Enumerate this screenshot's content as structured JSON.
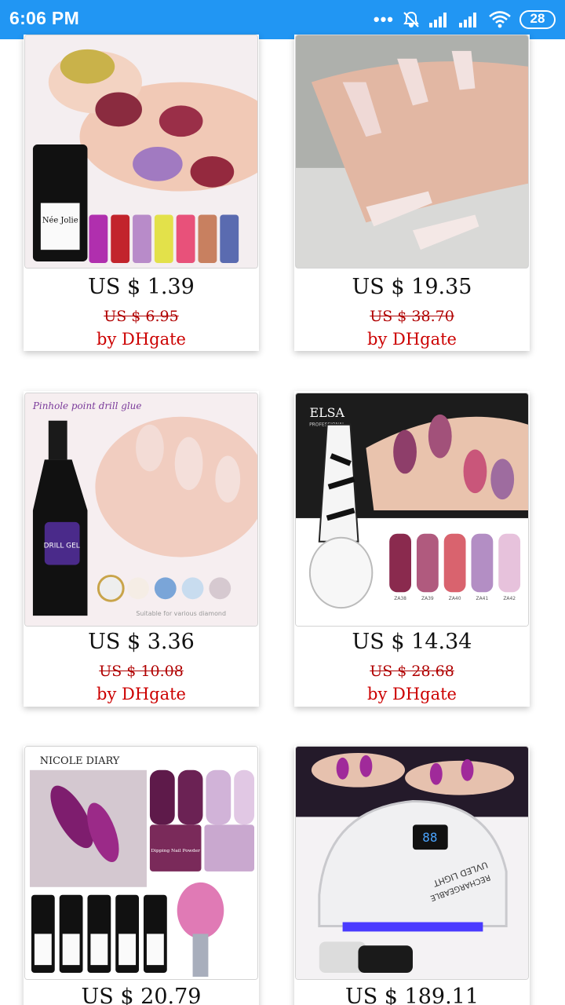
{
  "status_bar": {
    "time": "6:06 PM",
    "dots": "•••",
    "battery": "28",
    "icons": [
      "more-dots-icon",
      "notifications-off-icon",
      "signal-icon",
      "signal-icon",
      "wifi-icon",
      "battery-icon"
    ]
  },
  "products": [
    {
      "price": "US $ 1.39",
      "old_price": "US $ 6.95",
      "seller": "by DHgate",
      "image_brand": "Née Jolie",
      "image_caption": ""
    },
    {
      "price": "US $ 19.35",
      "old_price": "US $ 38.70",
      "seller": "by DHgate",
      "image_brand": "",
      "image_caption": ""
    },
    {
      "price": "US $ 3.36",
      "old_price": "US $ 10.08",
      "seller": "by DHgate",
      "image_brand": "DRILL GEL",
      "image_caption": "Pinhole point drill glue",
      "image_footer": "Suitable for various diamond"
    },
    {
      "price": "US $ 14.34",
      "old_price": "US $ 28.68",
      "seller": "by DHgate",
      "image_brand": "ELSA",
      "image_caption": "PROFESSIONAL",
      "image_labels": [
        "ZA38",
        "ZA39",
        "ZA40",
        "ZA41",
        "ZA42"
      ]
    },
    {
      "price": "US $ 20.79",
      "old_price": "",
      "seller": "",
      "image_brand": "NICOLE DIARY",
      "image_caption": "Dipping Nail Powder"
    },
    {
      "price": "US $ 189.11",
      "old_price": "",
      "seller": "",
      "image_brand": "UVLED LIGHT",
      "image_caption": "RECHARGEABLE"
    }
  ],
  "colors": {
    "status_bar_bg": "#2196F3",
    "old_price": "#b00000",
    "seller": "#cc0000"
  }
}
